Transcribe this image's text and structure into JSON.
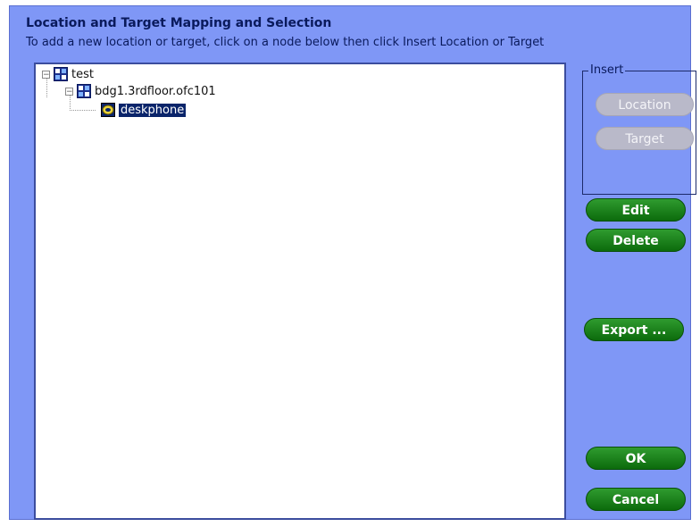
{
  "dialog": {
    "title": "Location and Target Mapping and Selection",
    "subtitle": "To add a new location or target, click on a node below then click Insert Location or Target"
  },
  "tree": {
    "nodes": [
      {
        "label": "test",
        "expanded": true,
        "icon": "location-grid-icon"
      },
      {
        "label": "bdg1.3rdfloor.ofc101",
        "expanded": true,
        "icon": "location-grid-icon"
      },
      {
        "label": "deskphone",
        "selected": true,
        "icon": "target-phone-icon"
      }
    ]
  },
  "insert": {
    "legend": "Insert",
    "location_label": "Location",
    "target_label": "Target"
  },
  "actions": {
    "edit_label": "Edit",
    "delete_label": "Delete",
    "export_label": "Export ...",
    "ok_label": "OK",
    "cancel_label": "Cancel"
  },
  "colors": {
    "dialog_bg": "#7f97f6",
    "button_green": "#1a7f1a",
    "selection": "#0a246a"
  }
}
